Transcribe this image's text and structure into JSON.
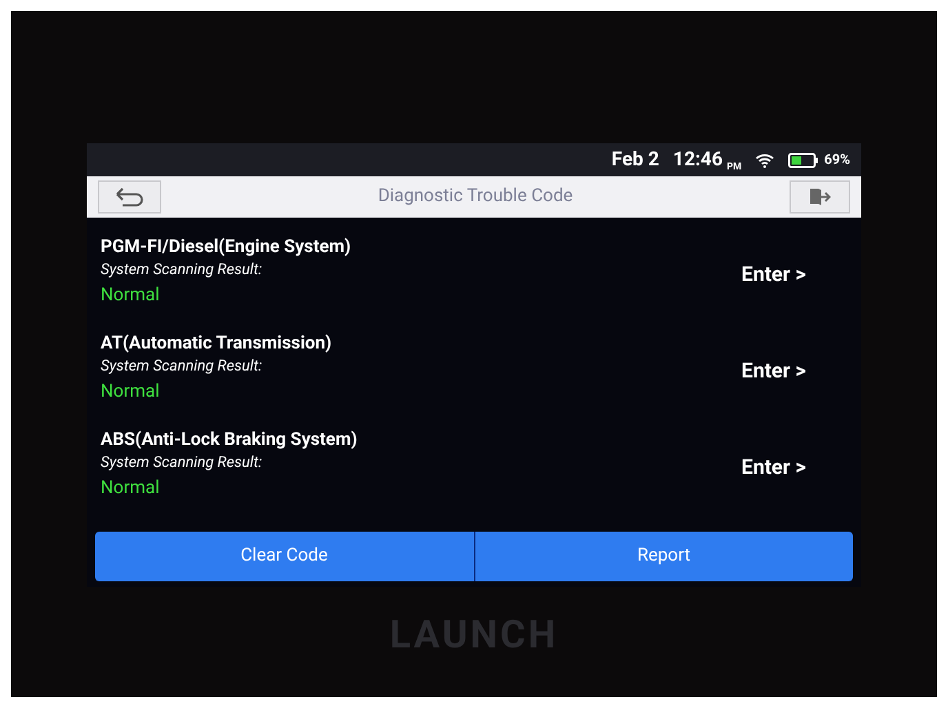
{
  "status_bar": {
    "date": "Feb 2",
    "time": "12:46",
    "meridiem": "PM",
    "battery": "69%"
  },
  "header": {
    "title": "Diagnostic Trouble Code"
  },
  "systems": [
    {
      "name": "PGM-FI/Diesel(Engine System)",
      "result_label": "System Scanning Result:",
      "status": "Normal",
      "action": "Enter >"
    },
    {
      "name": "AT(Automatic Transmission)",
      "result_label": "System Scanning Result:",
      "status": "Normal",
      "action": "Enter >"
    },
    {
      "name": "ABS(Anti-Lock Braking System)",
      "result_label": "System Scanning Result:",
      "status": "Normal",
      "action": "Enter >"
    }
  ],
  "buttons": [
    {
      "label": "Clear Code"
    },
    {
      "label": "Report"
    }
  ],
  "device_logo": "LAUNCH"
}
